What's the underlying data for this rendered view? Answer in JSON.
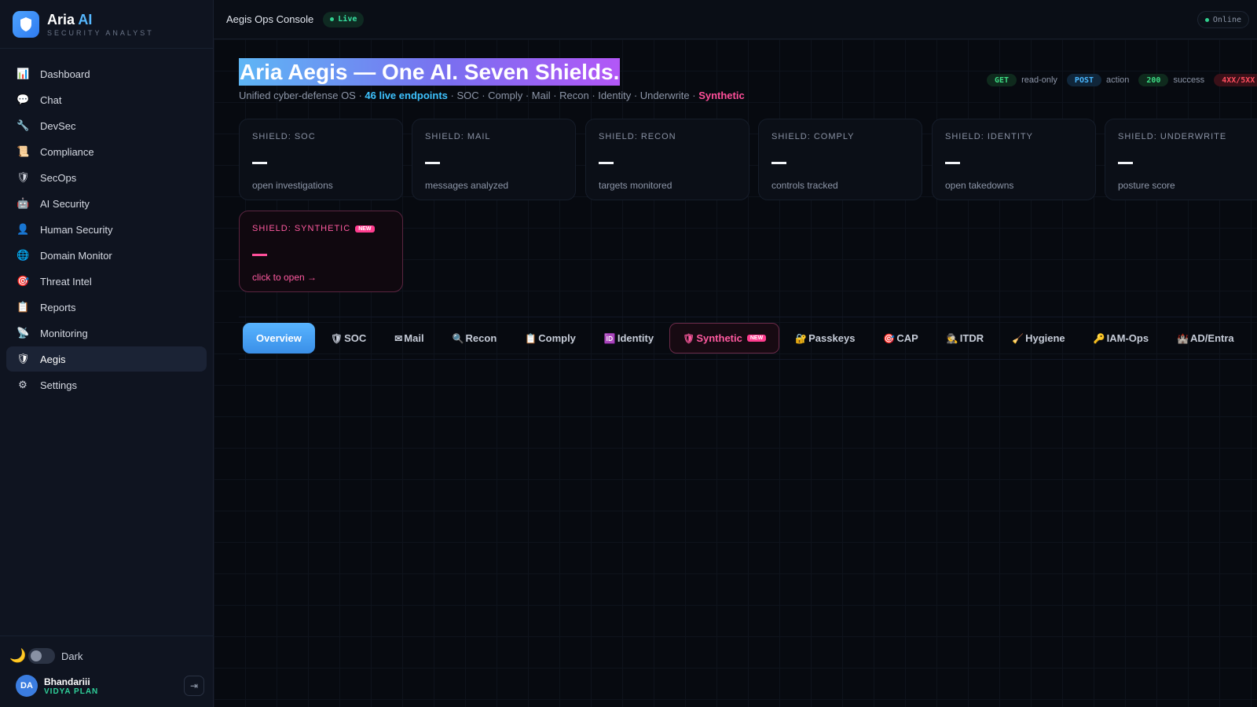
{
  "brand": {
    "name_main": "Aria ",
    "name_accent": "AI",
    "subtitle": "SECURITY ANALYST"
  },
  "sidebar": {
    "items": [
      {
        "label": "Dashboard",
        "icon": "📊"
      },
      {
        "label": "Chat",
        "icon": "💬"
      },
      {
        "label": "DevSec",
        "icon": "🔧"
      },
      {
        "label": "Compliance",
        "icon": "📜"
      },
      {
        "label": "SecOps",
        "icon": "🛡"
      },
      {
        "label": "AI Security",
        "icon": "🤖"
      },
      {
        "label": "Human Security",
        "icon": "👤"
      },
      {
        "label": "Domain Monitor",
        "icon": "🌐"
      },
      {
        "label": "Threat Intel",
        "icon": "🎯"
      },
      {
        "label": "Reports",
        "icon": "📋"
      },
      {
        "label": "Monitoring",
        "icon": "📡"
      },
      {
        "label": "Aegis",
        "icon": "🛡"
      },
      {
        "label": "Settings",
        "icon": "⚙"
      }
    ],
    "active": "Aegis"
  },
  "footer": {
    "theme_icon": "🌙",
    "theme_label": "Dark",
    "user_initials": "DA",
    "user_name": "Bhandariii",
    "user_plan": "VIDYA PLAN",
    "logout_icon": "⇥"
  },
  "topbar": {
    "title": "Aegis Ops Console",
    "live_label": "Live",
    "online_label": "Online"
  },
  "hero": {
    "title": "Aria Aegis — One AI. Seven Shields.",
    "sub_prefix": "Unified cyber-defense OS · ",
    "sub_endpoints": "46 live endpoints",
    "sub_middle": " · SOC · Comply · Mail · Recon · Identity · Underwrite · ",
    "sub_synthetic": "Synthetic"
  },
  "legend": [
    {
      "tag": "GET",
      "label": "read-only"
    },
    {
      "tag": "POST",
      "label": "action"
    },
    {
      "tag": "200",
      "label": "success"
    },
    {
      "tag": "4XX/5XX",
      "label": ""
    }
  ],
  "shields": [
    {
      "label": "SHIELD: SOC",
      "value": "—",
      "desc": "open investigations"
    },
    {
      "label": "SHIELD: MAIL",
      "value": "—",
      "desc": "messages analyzed"
    },
    {
      "label": "SHIELD: RECON",
      "value": "—",
      "desc": "targets monitored"
    },
    {
      "label": "SHIELD: COMPLY",
      "value": "—",
      "desc": "controls tracked"
    },
    {
      "label": "SHIELD: IDENTITY",
      "value": "—",
      "desc": "open takedowns"
    },
    {
      "label": "SHIELD: UNDERWRITE",
      "value": "—",
      "desc": "posture score"
    },
    {
      "label": "SHIELD: SYNTHETIC",
      "badge": "NEW",
      "value": "—",
      "desc": "click to open →"
    }
  ],
  "tabs": [
    {
      "label": "Overview",
      "icon": ""
    },
    {
      "label": "SOC",
      "icon": "🛡"
    },
    {
      "label": "Mail",
      "icon": "✉"
    },
    {
      "label": "Recon",
      "icon": "🔍"
    },
    {
      "label": "Comply",
      "icon": "📋"
    },
    {
      "label": "Identity",
      "icon": "🆔"
    },
    {
      "label": "Synthetic",
      "icon": "🛡",
      "badge": "NEW"
    },
    {
      "label": "Passkeys",
      "icon": "🔐"
    },
    {
      "label": "CAP",
      "icon": "🎯"
    },
    {
      "label": "ITDR",
      "icon": "🕵"
    },
    {
      "label": "Hygiene",
      "icon": "🧹"
    },
    {
      "label": "IAM-Ops",
      "icon": "🔑"
    },
    {
      "label": "AD/Entra",
      "icon": "🏰"
    }
  ],
  "colors": {
    "accent": "#3ec3ff",
    "synthetic": "#ff4f9a",
    "live": "#31d08f"
  }
}
